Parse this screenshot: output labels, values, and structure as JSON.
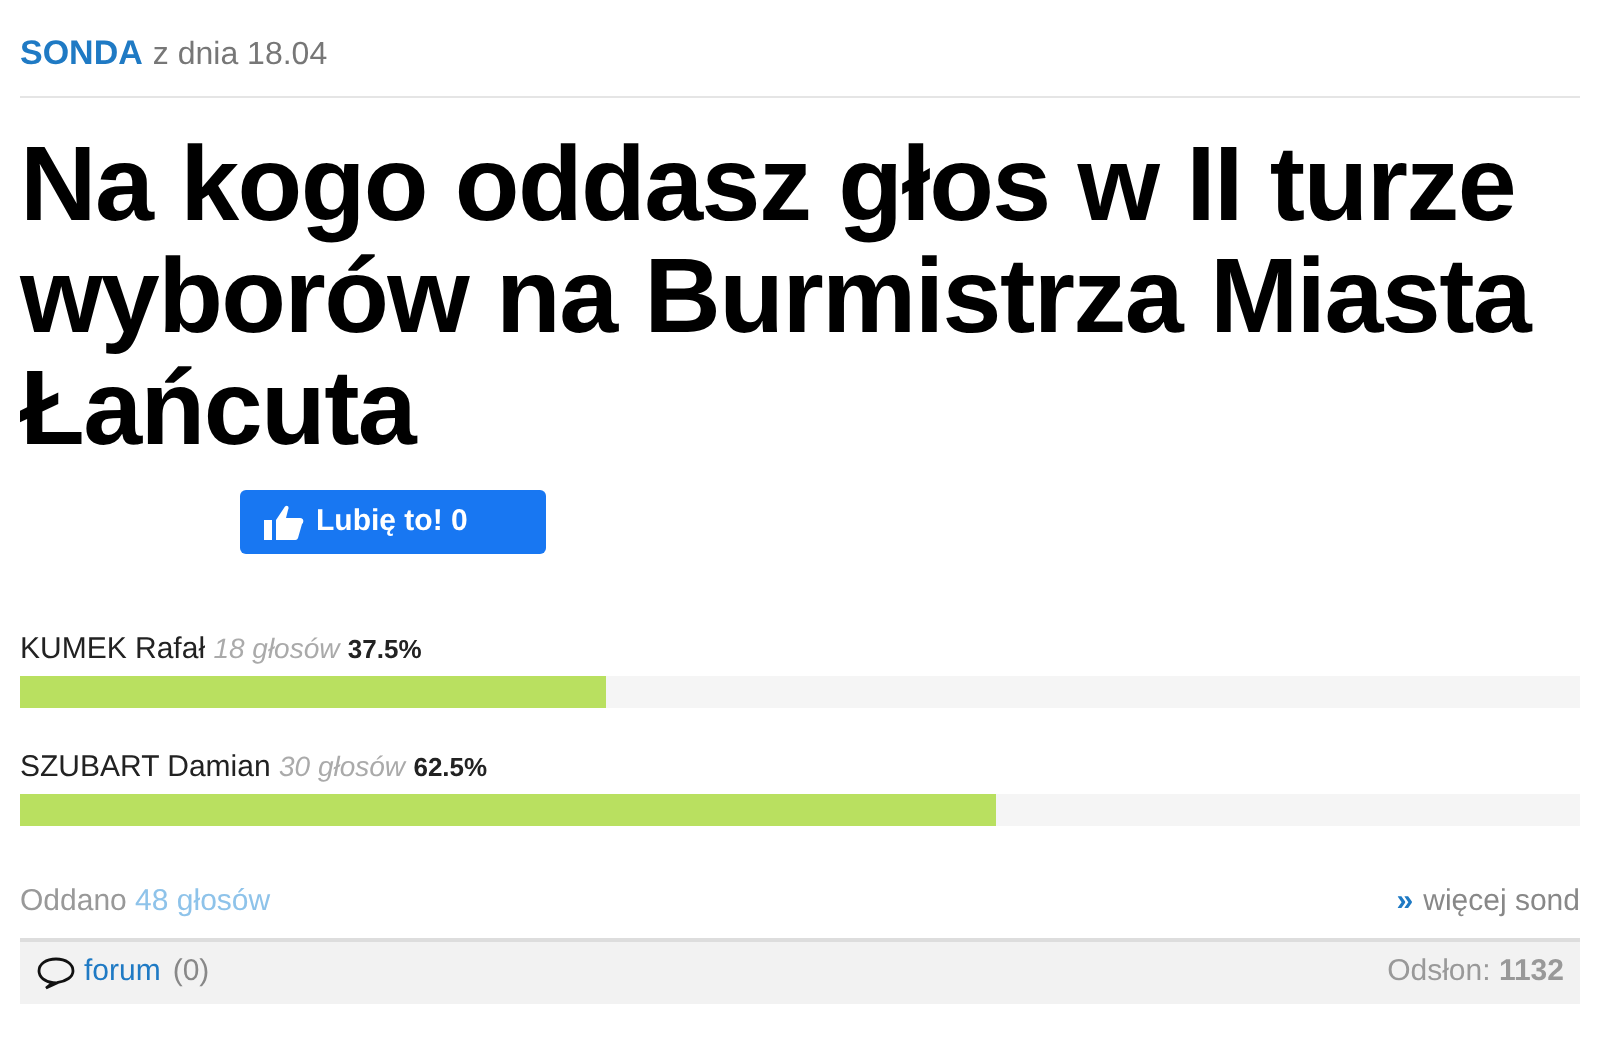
{
  "header": {
    "section": "SONDA",
    "date": "z dnia 18.04"
  },
  "title": "Na kogo oddasz głos w II turze wyborów na Burmistrza Miasta Łańcuta",
  "like_button": {
    "label": "Lubię to!",
    "count": "0"
  },
  "candidates": [
    {
      "name": "KUMEK Rafał",
      "votes": "18 głosów",
      "percent": "37.5%",
      "level": 0.375
    },
    {
      "name": "SZUBART Damian",
      "votes": "30 głosów",
      "percent": "62.5%",
      "level": 0.625
    }
  ],
  "summary": {
    "label": "Oddano",
    "total": "48 głosów",
    "more_link": "więcej sond",
    "more_icon": "»"
  },
  "footer": {
    "forum_link": "forum",
    "forum_count": "(0)",
    "views_label": "Odsłon:",
    "views": "1132"
  }
}
